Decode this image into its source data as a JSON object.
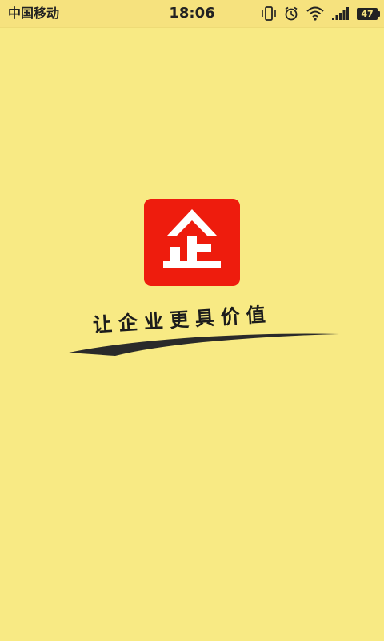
{
  "status_bar": {
    "carrier": "中国移动",
    "time": "18:06",
    "battery_level": "47",
    "icons": [
      "vibrate-icon",
      "alarm-icon",
      "wifi-icon",
      "signal-icon",
      "battery-icon"
    ]
  },
  "splash": {
    "logo_glyph": "企",
    "slogan": "让企业更具价值"
  },
  "colors": {
    "background": "#f8ea84",
    "logo_red": "#ee1c0d",
    "text_dark": "#1c1c1c"
  }
}
